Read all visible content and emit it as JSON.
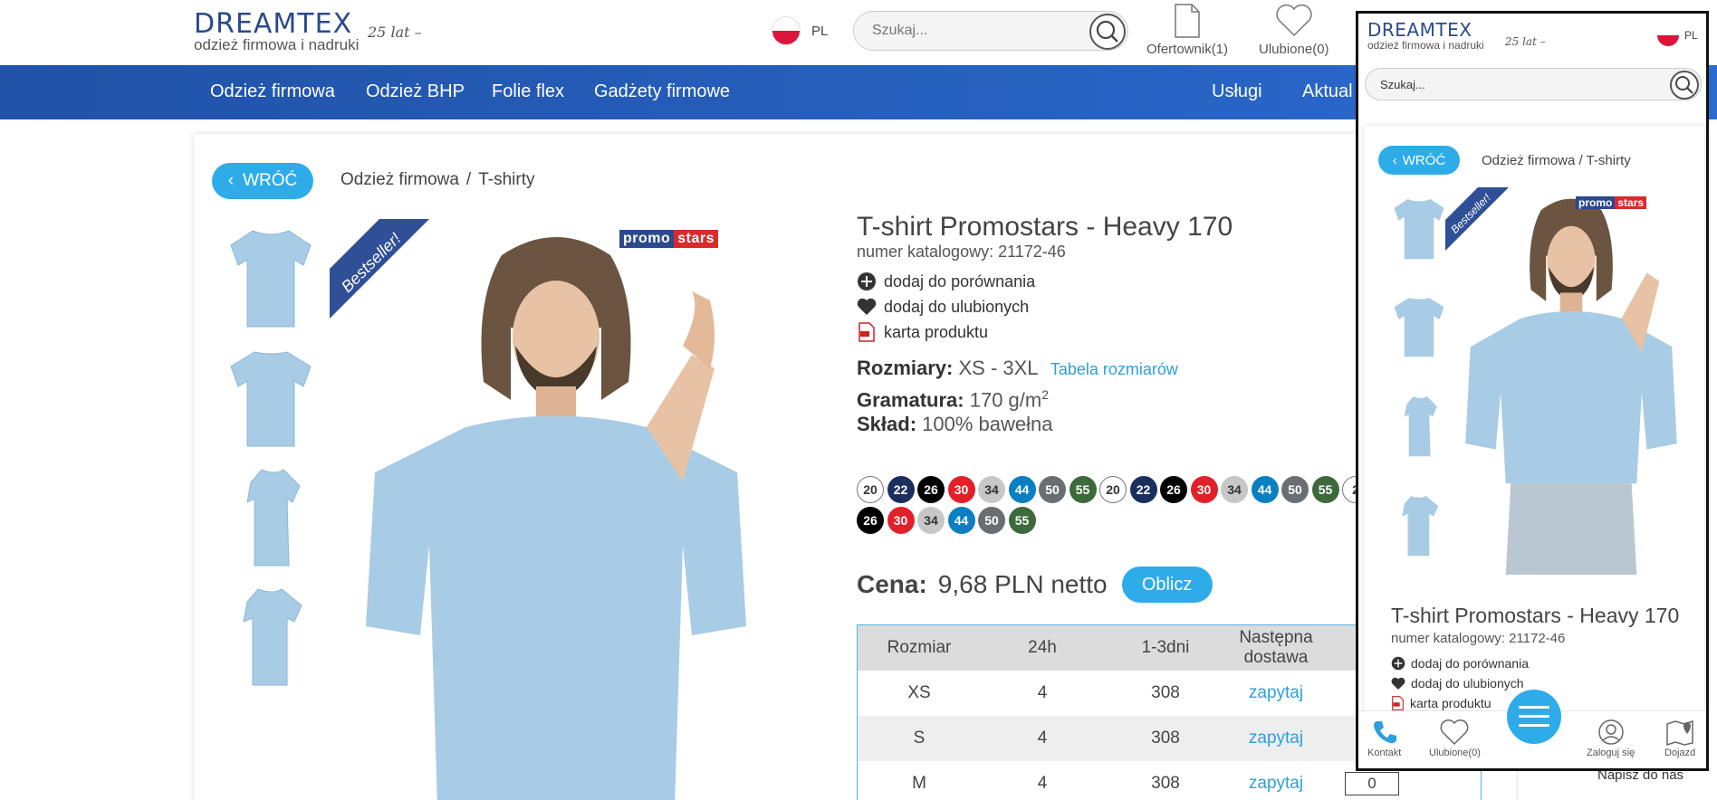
{
  "header": {
    "logo_brand": "DREAMTEX",
    "logo_tagline": "odzież firmowa i nadruki",
    "logo_anniversary": "25 lat –",
    "lang": "PL",
    "search_placeholder": "Szukaj...",
    "offer_label": "Ofertownik(1)",
    "fav_label": "Ulubione(0)"
  },
  "nav": {
    "items": [
      "Odzież firmowa",
      "Odzież BHP",
      "Folie flex",
      "Gadżety firmowe"
    ],
    "right_items": [
      "Usługi",
      "Aktual"
    ]
  },
  "product": {
    "back_label": "WRÓĆ",
    "breadcrumb": [
      "Odzież firmowa",
      "T-shirty"
    ],
    "ribbon": "Bestseller!",
    "brand_logo_a": "promo",
    "brand_logo_b": "stars",
    "title": "T-shirt Promostars - Heavy 170",
    "catalog": "numer katalogowy: 21172-46",
    "actions": [
      "dodaj do porównania",
      "dodaj do ulubionych",
      "karta produktu"
    ],
    "sizes_label": "Rozmiary:",
    "sizes_value": "XS - 3XL",
    "sizes_link": "Tabela rozmiarów",
    "weight_label": "Gramatura:",
    "weight_value": "170 g/m",
    "weight_sup": "2",
    "material_label": "Skład:",
    "material_value": "100% bawełna",
    "colors_row1": [
      {
        "n": "20",
        "bg": "#ffffff",
        "fg": "#333333"
      },
      {
        "n": "22",
        "bg": "#1b2f5e",
        "fg": "#ffffff"
      },
      {
        "n": "26",
        "bg": "#000000",
        "fg": "#ffffff"
      },
      {
        "n": "30",
        "bg": "#e3202a",
        "fg": "#ffffff"
      },
      {
        "n": "34",
        "bg": "#c7c7c7",
        "fg": "#333333"
      },
      {
        "n": "44",
        "bg": "#0a7fc2",
        "fg": "#ffffff"
      },
      {
        "n": "50",
        "bg": "#6a6e72",
        "fg": "#ffffff"
      },
      {
        "n": "55",
        "bg": "#3c6a3a",
        "fg": "#ffffff"
      },
      {
        "n": "20",
        "bg": "#ffffff",
        "fg": "#333333"
      },
      {
        "n": "22",
        "bg": "#1b2f5e",
        "fg": "#ffffff"
      },
      {
        "n": "26",
        "bg": "#000000",
        "fg": "#ffffff"
      },
      {
        "n": "30",
        "bg": "#e3202a",
        "fg": "#ffffff"
      },
      {
        "n": "34",
        "bg": "#c7c7c7",
        "fg": "#333333"
      },
      {
        "n": "44",
        "bg": "#0a7fc2",
        "fg": "#ffffff"
      },
      {
        "n": "50",
        "bg": "#6a6e72",
        "fg": "#ffffff"
      },
      {
        "n": "55",
        "bg": "#3c6a3a",
        "fg": "#ffffff"
      },
      {
        "n": "2",
        "bg": "#ffffff",
        "fg": "#333333"
      }
    ],
    "colors_row2": [
      {
        "n": "26",
        "bg": "#000000",
        "fg": "#ffffff"
      },
      {
        "n": "30",
        "bg": "#e3202a",
        "fg": "#ffffff"
      },
      {
        "n": "34",
        "bg": "#c7c7c7",
        "fg": "#333333"
      },
      {
        "n": "44",
        "bg": "#0a7fc2",
        "fg": "#ffffff"
      },
      {
        "n": "50",
        "bg": "#6a6e72",
        "fg": "#ffffff"
      },
      {
        "n": "55",
        "bg": "#3c6a3a",
        "fg": "#ffffff"
      }
    ],
    "price_label": "Cena:",
    "price_value": "9,68 PLN netto",
    "calc_label": "Oblicz",
    "table": {
      "headers": [
        "Rozmiar",
        "24h",
        "1-3dni",
        "Następna dostawa"
      ],
      "rows": [
        {
          "size": "XS",
          "h24": "4",
          "d13": "308",
          "next": "zapytaj"
        },
        {
          "size": "S",
          "h24": "4",
          "d13": "308",
          "next": "zapytaj"
        },
        {
          "size": "M",
          "h24": "4",
          "d13": "308",
          "next": "zapytaj",
          "qty": "0"
        }
      ]
    }
  },
  "mobile": {
    "logo_brand": "DREAMTEX",
    "logo_tagline": "odzież firmowa i nadruki",
    "logo_anniversary": "25 lat –",
    "lang": "PL",
    "search_placeholder": "Szukaj...",
    "back_label": "WRÓĆ",
    "breadcrumb": [
      "Odzież firmowa",
      "T-shirty"
    ],
    "ribbon": "Bestseller!",
    "brand_logo_a": "promo",
    "brand_logo_b": "stars",
    "title": "T-shirt Promostars - Heavy 170",
    "catalog": "numer katalogowy: 21172-46",
    "actions": [
      "dodaj do porównania",
      "dodaj do ulubionych",
      "karta produktu"
    ],
    "bottom": [
      "Kontakt",
      "Ulubione(0)",
      "Zaloguj się",
      "Dojazd"
    ]
  },
  "footer": {
    "write_us": "Napisz do nas"
  },
  "colors": {
    "accent": "#2eacea",
    "nav": "#2152a8",
    "shirt": "#a8cbe6"
  }
}
